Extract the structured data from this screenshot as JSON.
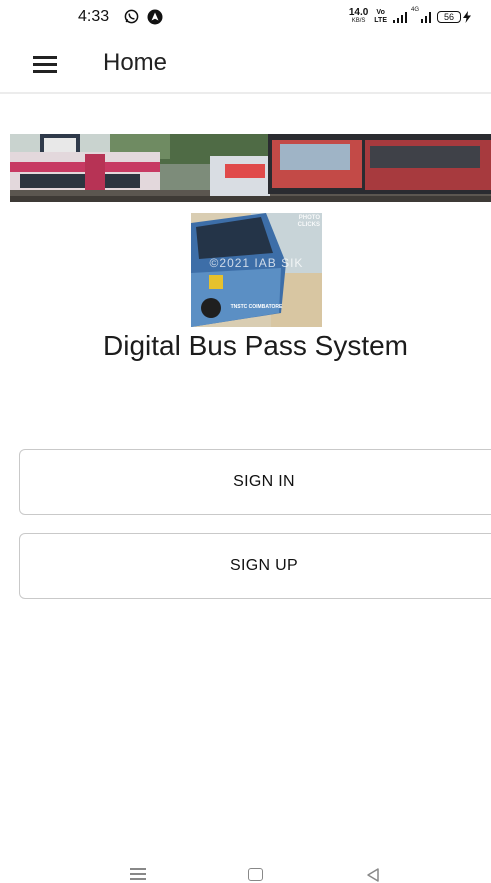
{
  "status_bar": {
    "time": "4:33",
    "net_speed_value": "14.0",
    "net_speed_unit": "KB/S",
    "volte_top": "Vo",
    "volte_bottom": "LTE",
    "signal2_label": "4G",
    "battery": "56",
    "icons": [
      "whatsapp-icon",
      "navigation-icon",
      "signal-icon",
      "battery-icon",
      "charging-icon"
    ]
  },
  "app_bar": {
    "title": "Home",
    "menu_icon": "hamburger-menu-icon"
  },
  "bus_photo": {
    "watermark": "©2021 IAB SIK",
    "clicks_line1": "PHOTO",
    "clicks_line2": "CLICKS",
    "caption": "TNSTC COIMBATORE"
  },
  "headline": "Digital Bus Pass System",
  "buttons": {
    "sign_in": "SIGN IN",
    "sign_up": "SIGN UP"
  },
  "nav_bar": {
    "icons": [
      "recent-apps-icon",
      "home-icon",
      "back-icon"
    ]
  }
}
